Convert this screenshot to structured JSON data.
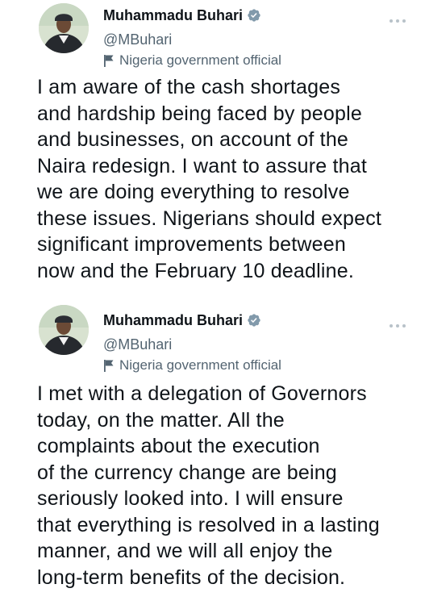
{
  "tweets": [
    {
      "author": {
        "display_name": "Muhammadu Buhari",
        "handle": "@MBuhari",
        "label": "Nigeria government official",
        "verified": true
      },
      "text_lines": [
        "I am aware of the cash shortages",
        "and hardship being faced by people",
        "and businesses, on account of the",
        "Naira redesign. I want to assure that",
        "we are doing everything to resolve",
        "these issues. Nigerians should expect",
        "significant improvements between",
        "now and the February 10 deadline."
      ]
    },
    {
      "author": {
        "display_name": "Muhammadu Buhari",
        "handle": "@MBuhari",
        "label": "Nigeria government official",
        "verified": true
      },
      "text_lines": [
        "I met with a delegation of Governors",
        "today, on the matter. All the",
        "complaints about the execution",
        "of the currency change are being",
        "seriously looked into. I will ensure",
        "that everything is resolved in a lasting",
        "manner, and we will all enjoy the",
        "long-term benefits of the decision."
      ]
    }
  ],
  "colors": {
    "text": "#0f1419",
    "secondary_text": "#536471",
    "verified_badge": "#829aab",
    "background": "#ffffff"
  },
  "icons": {
    "verified": "verified-badge-icon",
    "label_flag": "flag-icon",
    "more": "more-options-icon"
  }
}
